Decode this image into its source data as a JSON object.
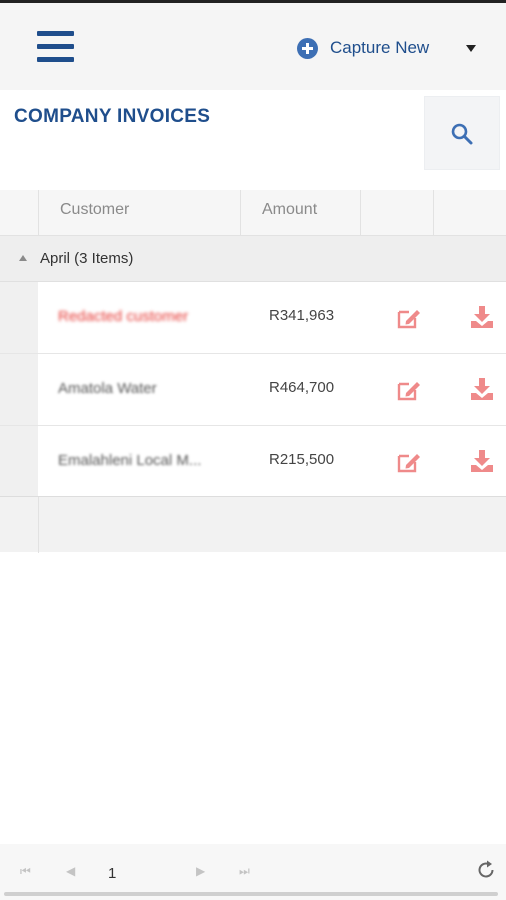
{
  "header": {
    "capture_label": "Capture New",
    "menu_icon": "hamburger-icon",
    "capture_icon": "plus-circle-icon",
    "dropdown_icon": "caret-down-icon"
  },
  "page": {
    "title": "COMPANY INVOICES",
    "search_icon": "search-icon"
  },
  "grid": {
    "columns": [
      "Customer",
      "Amount",
      "",
      ""
    ],
    "group_label": "April (3 Items)",
    "rows": [
      {
        "customer": "Redacted customer",
        "amount": "R341,963"
      },
      {
        "customer": "Amatola Water",
        "amount": "R464,700"
      },
      {
        "customer": "Emalahleni Local M...",
        "amount": "R215,500"
      }
    ],
    "action_icons": [
      "edit-icon",
      "download-icon"
    ]
  },
  "pager": {
    "current_page": "1",
    "icons": [
      "first-page-icon",
      "prev-page-icon",
      "next-page-icon",
      "last-page-icon",
      "refresh-icon"
    ]
  },
  "colors": {
    "brand": "#1f4e8c",
    "action_icon": "#ef8a8a",
    "header_bg": "#f5f5f5"
  }
}
